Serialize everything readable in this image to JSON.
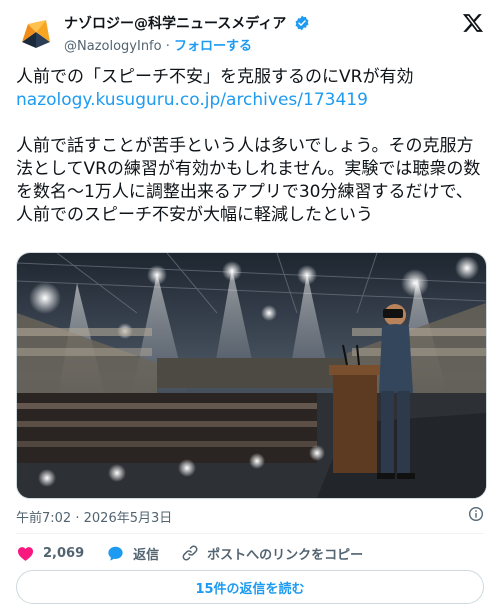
{
  "author": {
    "name": "ナゾロジー@科学ニュースメディア",
    "handle": "@NazologyInfo",
    "separator": "·",
    "follow_label": "フォローする"
  },
  "tweet": {
    "headline": "人前での「スピーチ不安」を克服するのにVRが有効",
    "link": "nazology.kusuguru.co.jp/archives/173419",
    "body": "人前で話すことが苦手という人は多いでしょう。その克服方法としてVRの練習が有効かもしれません。実験では聴衆の数を数名〜1万人に調整出来るアプリで30分練習するだけで、人前でのスピーチ不安が大幅に軽減したという"
  },
  "meta": {
    "time": "午前7:02",
    "separator": "·",
    "date": "2026年5月3日"
  },
  "actions": {
    "like_count": "2,069",
    "reply_label": "返信",
    "copy_link_label": "ポストへのリンクをコピー"
  },
  "replies_button": "15件の返信を読む",
  "colors": {
    "accent": "#1d9bf0",
    "like": "#f91880",
    "muted": "#536471"
  }
}
